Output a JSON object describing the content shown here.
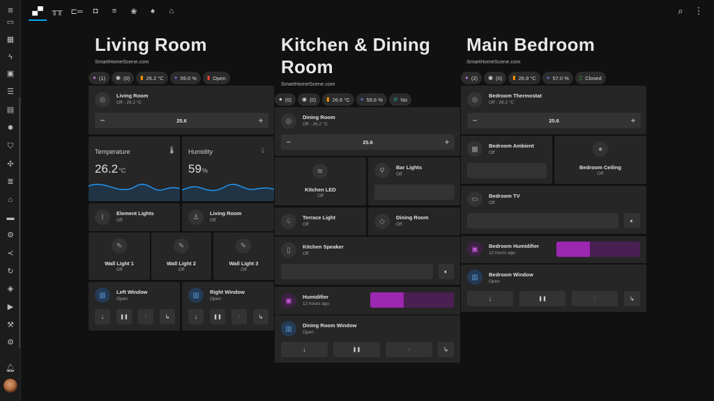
{
  "sidebar": {
    "icons": [
      "menu-icon",
      "monitor-icon",
      "stove-icon",
      "lightning-icon",
      "account-box-icon",
      "list-icon",
      "chart-icon",
      "cog-icon",
      "shield-icon",
      "network-icon",
      "server-icon",
      "store-icon",
      "panel-icon",
      "gear-icon",
      "vscode-icon",
      "history-icon",
      "compass-icon",
      "media-icon",
      "hammer-icon",
      "settings-icon",
      "bell-icon",
      "avatar-icon"
    ]
  },
  "topbar": {
    "tabs": [
      "sofa-icon",
      "dining-table-icon",
      "bed-icon",
      "washer-icon",
      "stairs-icon",
      "flower-icon",
      "garden-icon",
      "house-icon"
    ],
    "active_tab": 0
  },
  "living_room": {
    "title": "Living Room",
    "subtitle": "SmartHomeScene.com",
    "chips": [
      {
        "icon": "person-icon",
        "text": "(1)",
        "color": "#b06fd0"
      },
      {
        "icon": "motion-icon",
        "text": "(0)",
        "color": "#bdbdbd"
      },
      {
        "icon": "thermometer-icon",
        "text": "26.2 °C",
        "color": "#ff9800"
      },
      {
        "icon": "drop-icon",
        "text": "59.0 %",
        "color": "#5c6bc0"
      },
      {
        "icon": "door-icon",
        "text": "Open",
        "color": "#f44336"
      }
    ],
    "thermostat": {
      "name": "Living Room",
      "state": "Off - 26.2 °C",
      "setpoint": "25.6",
      "minus": "−",
      "plus": "+"
    },
    "temperature": {
      "title": "Temperature",
      "value": "26.2",
      "unit": "°C"
    },
    "humidity": {
      "title": "Humidity",
      "value": "59",
      "unit": "%"
    },
    "element_lights": {
      "name": "Element Lights",
      "state": "Off"
    },
    "living_room_light": {
      "name": "Living Room",
      "state": "Off"
    },
    "wall_light_1": {
      "name": "Wall Light 1",
      "state": "Off"
    },
    "wall_light_2": {
      "name": "Wall Light 2",
      "state": "Off"
    },
    "wall_light_3": {
      "name": "Wall Light 3",
      "state": "Off"
    },
    "left_window": {
      "name": "Left Window",
      "state": "Open"
    },
    "right_window": {
      "name": "Right Window",
      "state": "Open"
    }
  },
  "kitchen": {
    "title": "Kitchen & Dining Room",
    "subtitle": "SmartHomeScene.com",
    "chips": [
      {
        "icon": "person-icon",
        "text": "(0)",
        "color": "#bdbdbd"
      },
      {
        "icon": "motion-icon",
        "text": "(0)",
        "color": "#bdbdbd"
      },
      {
        "icon": "thermometer-icon",
        "text": "26.6 °C",
        "color": "#ff9800"
      },
      {
        "icon": "drop-icon",
        "text": "59.6 %",
        "color": "#5c6bc0"
      },
      {
        "icon": "leak-icon",
        "text": "No",
        "color": "#26a69a"
      }
    ],
    "thermostat": {
      "name": "Dining Room",
      "state": "Off - 26.2 °C",
      "setpoint": "25.6",
      "minus": "−",
      "plus": "+"
    },
    "kitchen_led": {
      "name": "Kitchen LED",
      "state": "Off"
    },
    "bar_lights": {
      "name": "Bar Lights",
      "state": "Off"
    },
    "terrace_light": {
      "name": "Terrace Light",
      "state": "Off"
    },
    "dining_room_light": {
      "name": "Dining Room",
      "state": "Off"
    },
    "kitchen_speaker": {
      "name": "Kitchen Speaker",
      "state": "Off"
    },
    "humidifier": {
      "name": "Humidifier",
      "state": "12 hours ago",
      "level": 0.4
    },
    "window": {
      "name": "Dining Room Window",
      "state": "Open"
    }
  },
  "bedroom": {
    "title": "Main Bedroom",
    "subtitle": "SmartHomeScene.com",
    "chips": [
      {
        "icon": "person-icon",
        "text": "(2)",
        "color": "#b06fd0"
      },
      {
        "icon": "motion-icon",
        "text": "(0)",
        "color": "#bdbdbd"
      },
      {
        "icon": "thermometer-icon",
        "text": "26.9 °C",
        "color": "#ff9800"
      },
      {
        "icon": "drop-icon",
        "text": "57.0 %",
        "color": "#5c6bc0"
      },
      {
        "icon": "door-icon",
        "text": "Closed",
        "color": "#4caf50"
      }
    ],
    "thermostat": {
      "name": "Bedroom Thermostat",
      "state": "Off - 26.2 °C",
      "setpoint": "25.6",
      "minus": "−",
      "plus": "+"
    },
    "ambient": {
      "name": "Bedroom Ambient",
      "state": "Off"
    },
    "ceiling": {
      "name": "Bedroom Ceiling",
      "state": "Off"
    },
    "tv": {
      "name": "Bedroom TV",
      "state": "Off"
    },
    "humidifier": {
      "name": "Bedroom Humidifier",
      "state": "12 hours ago",
      "level": 0.4
    },
    "window": {
      "name": "Bedroom Window",
      "state": "Open"
    }
  },
  "cover_buttons": {
    "down": "↓",
    "pause": "❚❚",
    "up": "↑",
    "tilt": "↳"
  },
  "colors": {
    "accent": "#03a9f4",
    "window_icon": "#5b9bd5",
    "humidifier": "#9c27b0",
    "chart_line": "#2196f3"
  }
}
